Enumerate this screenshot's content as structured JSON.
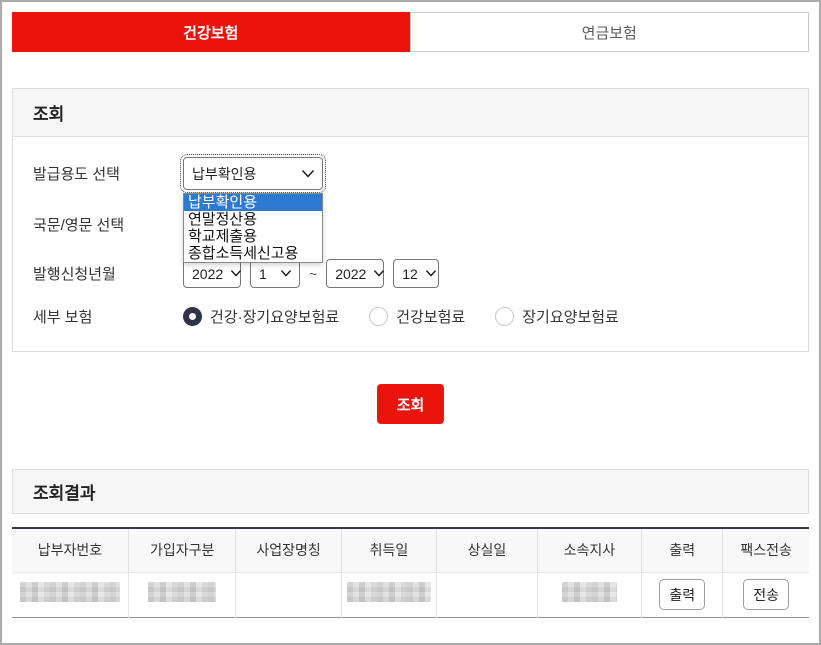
{
  "tabs": {
    "health": {
      "label": "건강보험",
      "active": true
    },
    "pension": {
      "label": "연금보험",
      "active": false
    }
  },
  "search_panel": {
    "title": "조회",
    "purpose": {
      "label": "발급용도 선택",
      "value": "납부확인용",
      "options": [
        "납부확인용",
        "연말정산용",
        "학교제출용",
        "종합소득세신고용"
      ],
      "selected_option": "납부확인용"
    },
    "language": {
      "label": "국문/영문 선택"
    },
    "period": {
      "label": "발행신청년월",
      "from_year": "2022",
      "from_month": "1",
      "separator": "~",
      "to_year": "2022",
      "to_month": "12"
    },
    "detail": {
      "label": "세부 보험",
      "options": [
        {
          "label": "건강·장기요양보험료",
          "selected": true
        },
        {
          "label": "건강보험료",
          "selected": false
        },
        {
          "label": "장기요양보험료",
          "selected": false
        }
      ]
    },
    "search_button": "조회"
  },
  "results": {
    "title": "조회결과",
    "columns": [
      "납부자번호",
      "가입자구분",
      "사업장명칭",
      "취득일",
      "상실일",
      "소속지사",
      "출력",
      "팩스전송"
    ],
    "row": {
      "print_button": "출력",
      "fax_button": "전송",
      "redacted_cells": [
        "납부자번호",
        "가입자구분",
        "취득일",
        "소속지사"
      ]
    }
  },
  "colors": {
    "accent_red": "#ea140d",
    "selection_blue": "#2d7ad3",
    "radio_dark": "#2f3248",
    "table_top_border": "#333647"
  }
}
